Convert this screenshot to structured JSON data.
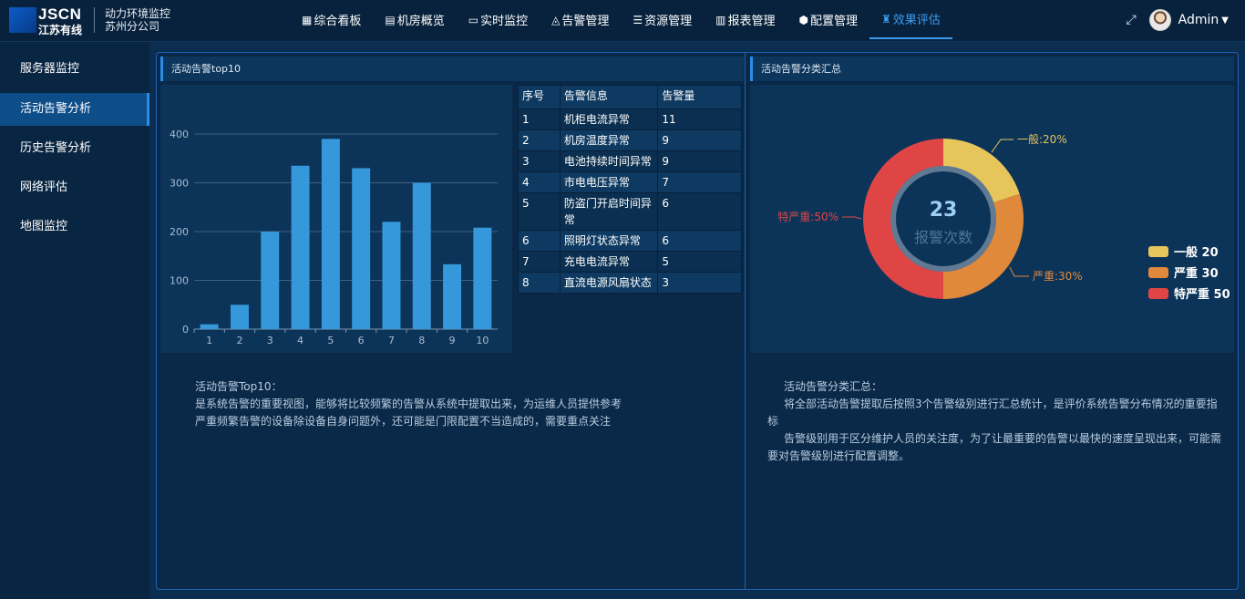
{
  "header": {
    "logo_text": "JSCN",
    "logo_sub": "江苏有线",
    "system_title_line1": "动力环境监控",
    "system_title_line2": "苏州分公司",
    "user": "Admin",
    "nav": [
      {
        "label": "综合看板",
        "icon": "grid-icon",
        "glyph": "▦",
        "active": false
      },
      {
        "label": "机房概览",
        "icon": "server-room-icon",
        "glyph": "▤",
        "active": false
      },
      {
        "label": "实时监控",
        "icon": "monitor-icon",
        "glyph": "▭",
        "active": false
      },
      {
        "label": "告警管理",
        "icon": "bell-icon",
        "glyph": "◬",
        "active": false
      },
      {
        "label": "资源管理",
        "icon": "database-icon",
        "glyph": "☰",
        "active": false
      },
      {
        "label": "报表管理",
        "icon": "bar-chart-icon",
        "glyph": "▥",
        "active": false
      },
      {
        "label": "配置管理",
        "icon": "cube-icon",
        "glyph": "⬢",
        "active": false
      },
      {
        "label": "效果评估",
        "icon": "sitemap-icon",
        "glyph": "♜",
        "active": true
      }
    ]
  },
  "sidebar": {
    "items": [
      {
        "label": "服务器监控",
        "active": false
      },
      {
        "label": "活动告警分析",
        "active": true
      },
      {
        "label": "历史告警分析",
        "active": false
      },
      {
        "label": "网络评估",
        "active": false
      },
      {
        "label": "地图监控",
        "active": false
      }
    ]
  },
  "top10_panel": {
    "title": "活动告警top10",
    "table_headers": [
      "序号",
      "告警信息",
      "告警量"
    ],
    "rows": [
      [
        "1",
        "机柜电流异常",
        "11"
      ],
      [
        "2",
        "机房温度异常",
        "9"
      ],
      [
        "3",
        "电池持续时间异常",
        "9"
      ],
      [
        "4",
        "市电电压异常",
        "7"
      ],
      [
        "5",
        "防盗门开启时间异常",
        "6"
      ],
      [
        "6",
        "照明灯状态异常",
        "6"
      ],
      [
        "7",
        "充电电流异常",
        "5"
      ],
      [
        "8",
        "直流电源风扇状态",
        "3"
      ]
    ],
    "description_title": "活动告警Top10：",
    "description_lines": [
      "是系统告警的重要视图，能够将比较频繁的告警从系统中提取出来，为运维人员提供参考",
      "严重频繁告警的设备除设备自身问题外，还可能是门限配置不当造成的，需要重点关注"
    ]
  },
  "summary_panel": {
    "title": "活动告警分类汇总",
    "center_value": "23",
    "center_label": "报警次数",
    "description_title": "活动告警分类汇总：",
    "description_lines": [
      "将全部活动告警提取后按照3个告警级别进行汇总统计，是评价系统告警分布情况的重要指标",
      "告警级别用于区分维护人员的关注度，为了让最重要的告警以最快的速度呈现出来，可能需要对告警级别进行配置调整。"
    ]
  },
  "colors": {
    "bar": "#3498db",
    "general": "#e6c55a",
    "serious": "#e0893a",
    "critical": "#e04545",
    "accent": "#2a8de8"
  },
  "chart_data": [
    {
      "type": "bar",
      "categories": [
        "1",
        "2",
        "3",
        "4",
        "5",
        "6",
        "7",
        "8",
        "9",
        "10"
      ],
      "values": [
        10,
        50,
        200,
        335,
        390,
        330,
        220,
        300,
        133,
        208
      ],
      "ylim": [
        0,
        400
      ],
      "yticks": [
        0,
        100,
        200,
        300,
        400
      ],
      "grid": true
    },
    {
      "type": "pie",
      "categories": [
        "一般",
        "严重",
        "特严重"
      ],
      "values": [
        20,
        30,
        50
      ],
      "slice_labels": [
        "一般:20%",
        "严重:30%",
        "特严重:50%"
      ],
      "legend": "right"
    }
  ]
}
